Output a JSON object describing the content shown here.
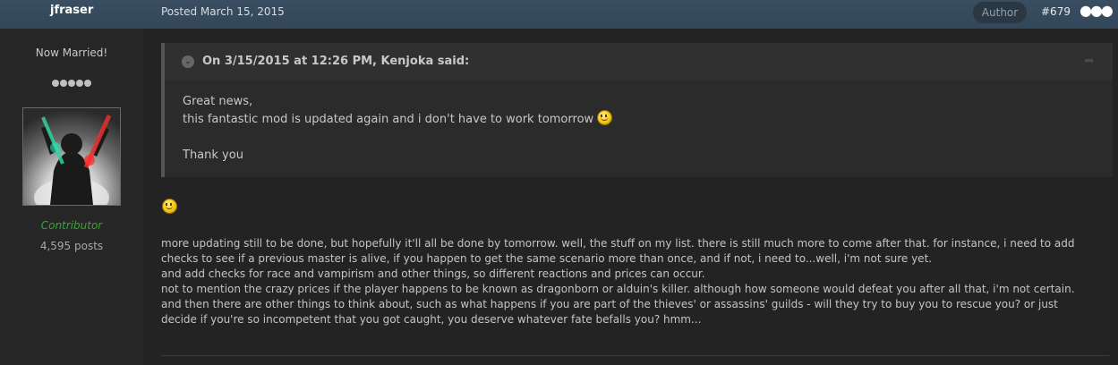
{
  "header": {
    "username": "jfraser",
    "posted": "Posted March 15, 2015",
    "author_badge": "Author",
    "post_number": "#679",
    "more_icon": "ellipsis-icon"
  },
  "user": {
    "title": "Now Married!",
    "rank_pips": 5,
    "group": "Contributor",
    "post_count": "4,595 posts",
    "group_color": "#31a931"
  },
  "quote": {
    "citation": "On 3/15/2015 at 12:26 PM, Kenjoka said:",
    "lines": [
      "Great news,",
      "this fantastic mod is updated again and i don't have to work tomorrow",
      "Thank you"
    ]
  },
  "post": {
    "paragraphs": [
      "more updating still to be done, but hopefully it'll all be done by tomorrow. well, the stuff on my list. there is still much more to come after that. for instance, i need to add",
      "checks to see if a previous master is alive, if you happen to get the same scenario more than once, and if not, i need to...well, i'm not sure yet.",
      "and add checks for race and vampirism and other things, so different reactions and prices can occur.",
      "not to mention the crazy prices if the player happens to be known as dragonborn or alduin's killer. although how someone would defeat you after all that, i'm not certain.",
      "and then there are other things to think about, such as what happens if you are part of the thieves' or assassins' guilds - will they try to buy you to rescue you? or just",
      "decide if you're so incompetent that you got caught, you deserve whatever fate befalls you? hmm..."
    ]
  }
}
